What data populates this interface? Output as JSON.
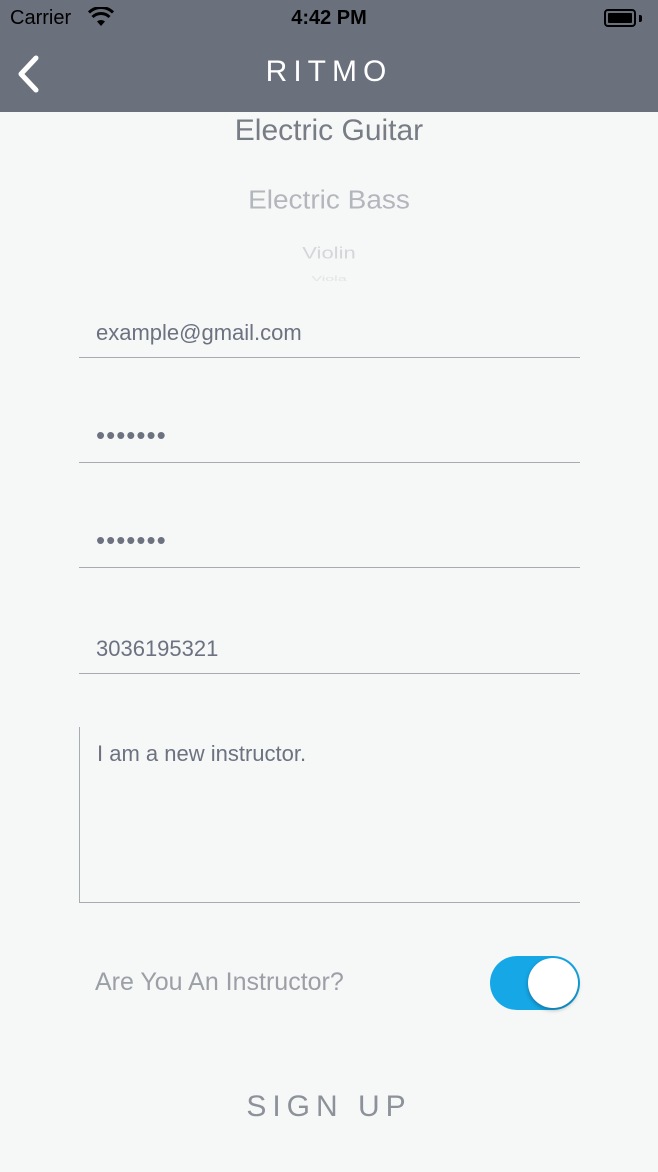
{
  "status_bar": {
    "carrier": "Carrier",
    "time": "4:42 PM"
  },
  "nav": {
    "title": "RITMO",
    "back_icon": "chevron-left-icon"
  },
  "picker": {
    "options": [
      "Electric Guitar",
      "Electric Bass",
      "Violin",
      "Viola"
    ],
    "selected": "Electric Guitar"
  },
  "form": {
    "email": "example@gmail.com",
    "password": "•••••••",
    "confirm_password": "•••••••",
    "phone": "3036195321",
    "bio": "I am a new instructor."
  },
  "instructor_toggle": {
    "label": "Are You An Instructor?",
    "on": true,
    "color": "#16a7e6"
  },
  "signup_label": "SIGN UP",
  "colors": {
    "nav_bg": "#6a717d",
    "page_bg": "#f6f7f7"
  }
}
